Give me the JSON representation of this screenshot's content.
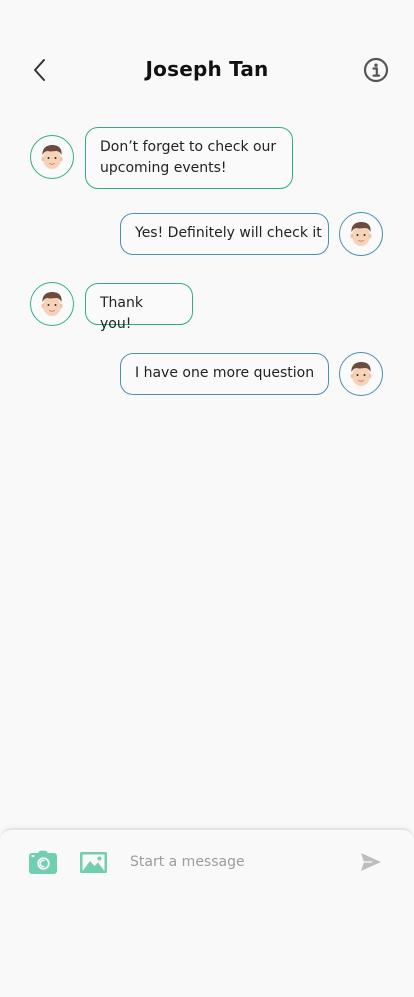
{
  "header": {
    "title": "Joseph Tan",
    "back_icon": "chevron-left-icon",
    "info_icon": "info-icon"
  },
  "messages": [
    {
      "direction": "incoming",
      "text": "Don’t forget to check our upcoming events!"
    },
    {
      "direction": "outgoing",
      "text": "Yes! Definitely will check it"
    },
    {
      "direction": "incoming",
      "text": "Thank you!"
    },
    {
      "direction": "outgoing",
      "text": "I have one more question"
    }
  ],
  "composer": {
    "placeholder": "Start a message",
    "value": "",
    "camera_icon": "camera-icon",
    "image_icon": "image-icon",
    "send_icon": "send-icon"
  },
  "colors": {
    "incoming_border": "#2fae86",
    "outgoing_border": "#4b8fb3",
    "accent_icon": "#6fcfb0",
    "send_icon": "#bdbdbd",
    "background": "#f9f9f9"
  }
}
